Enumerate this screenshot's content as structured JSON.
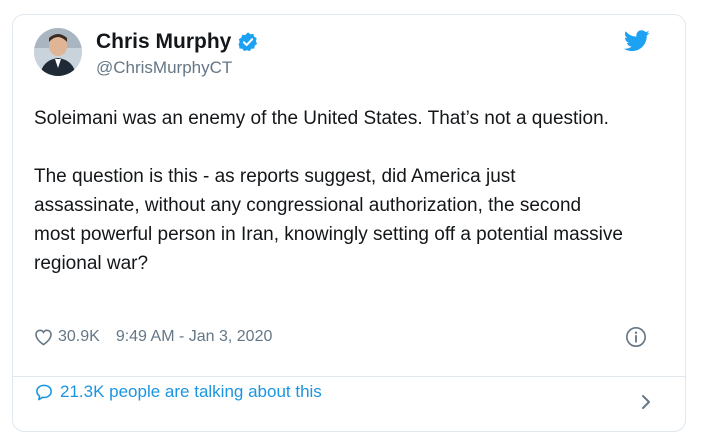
{
  "author": {
    "name": "Chris Murphy",
    "handle": "@ChrisMurphyCT",
    "avatar_icon": "person-avatar",
    "verified_icon": "verified-badge-icon"
  },
  "tweet": {
    "paragraphs": [
      "Soleimani was an enemy of the United States. That’s not a question.",
      "The question is this - as reports suggest, did America just assassinate, without any congressional authorization, the second most powerful person in Iran, knowingly setting off a potential massive regional war?"
    ]
  },
  "meta": {
    "likes": "30.9K",
    "timestamp": "9:49 AM - Jan 3, 2020"
  },
  "footer": {
    "talking": "21.3K people are talking about this"
  },
  "colors": {
    "twitter_blue": "#1da1f2",
    "link_blue": "#1b95e0",
    "secondary_text": "#657786",
    "border": "#e1e8ed"
  }
}
